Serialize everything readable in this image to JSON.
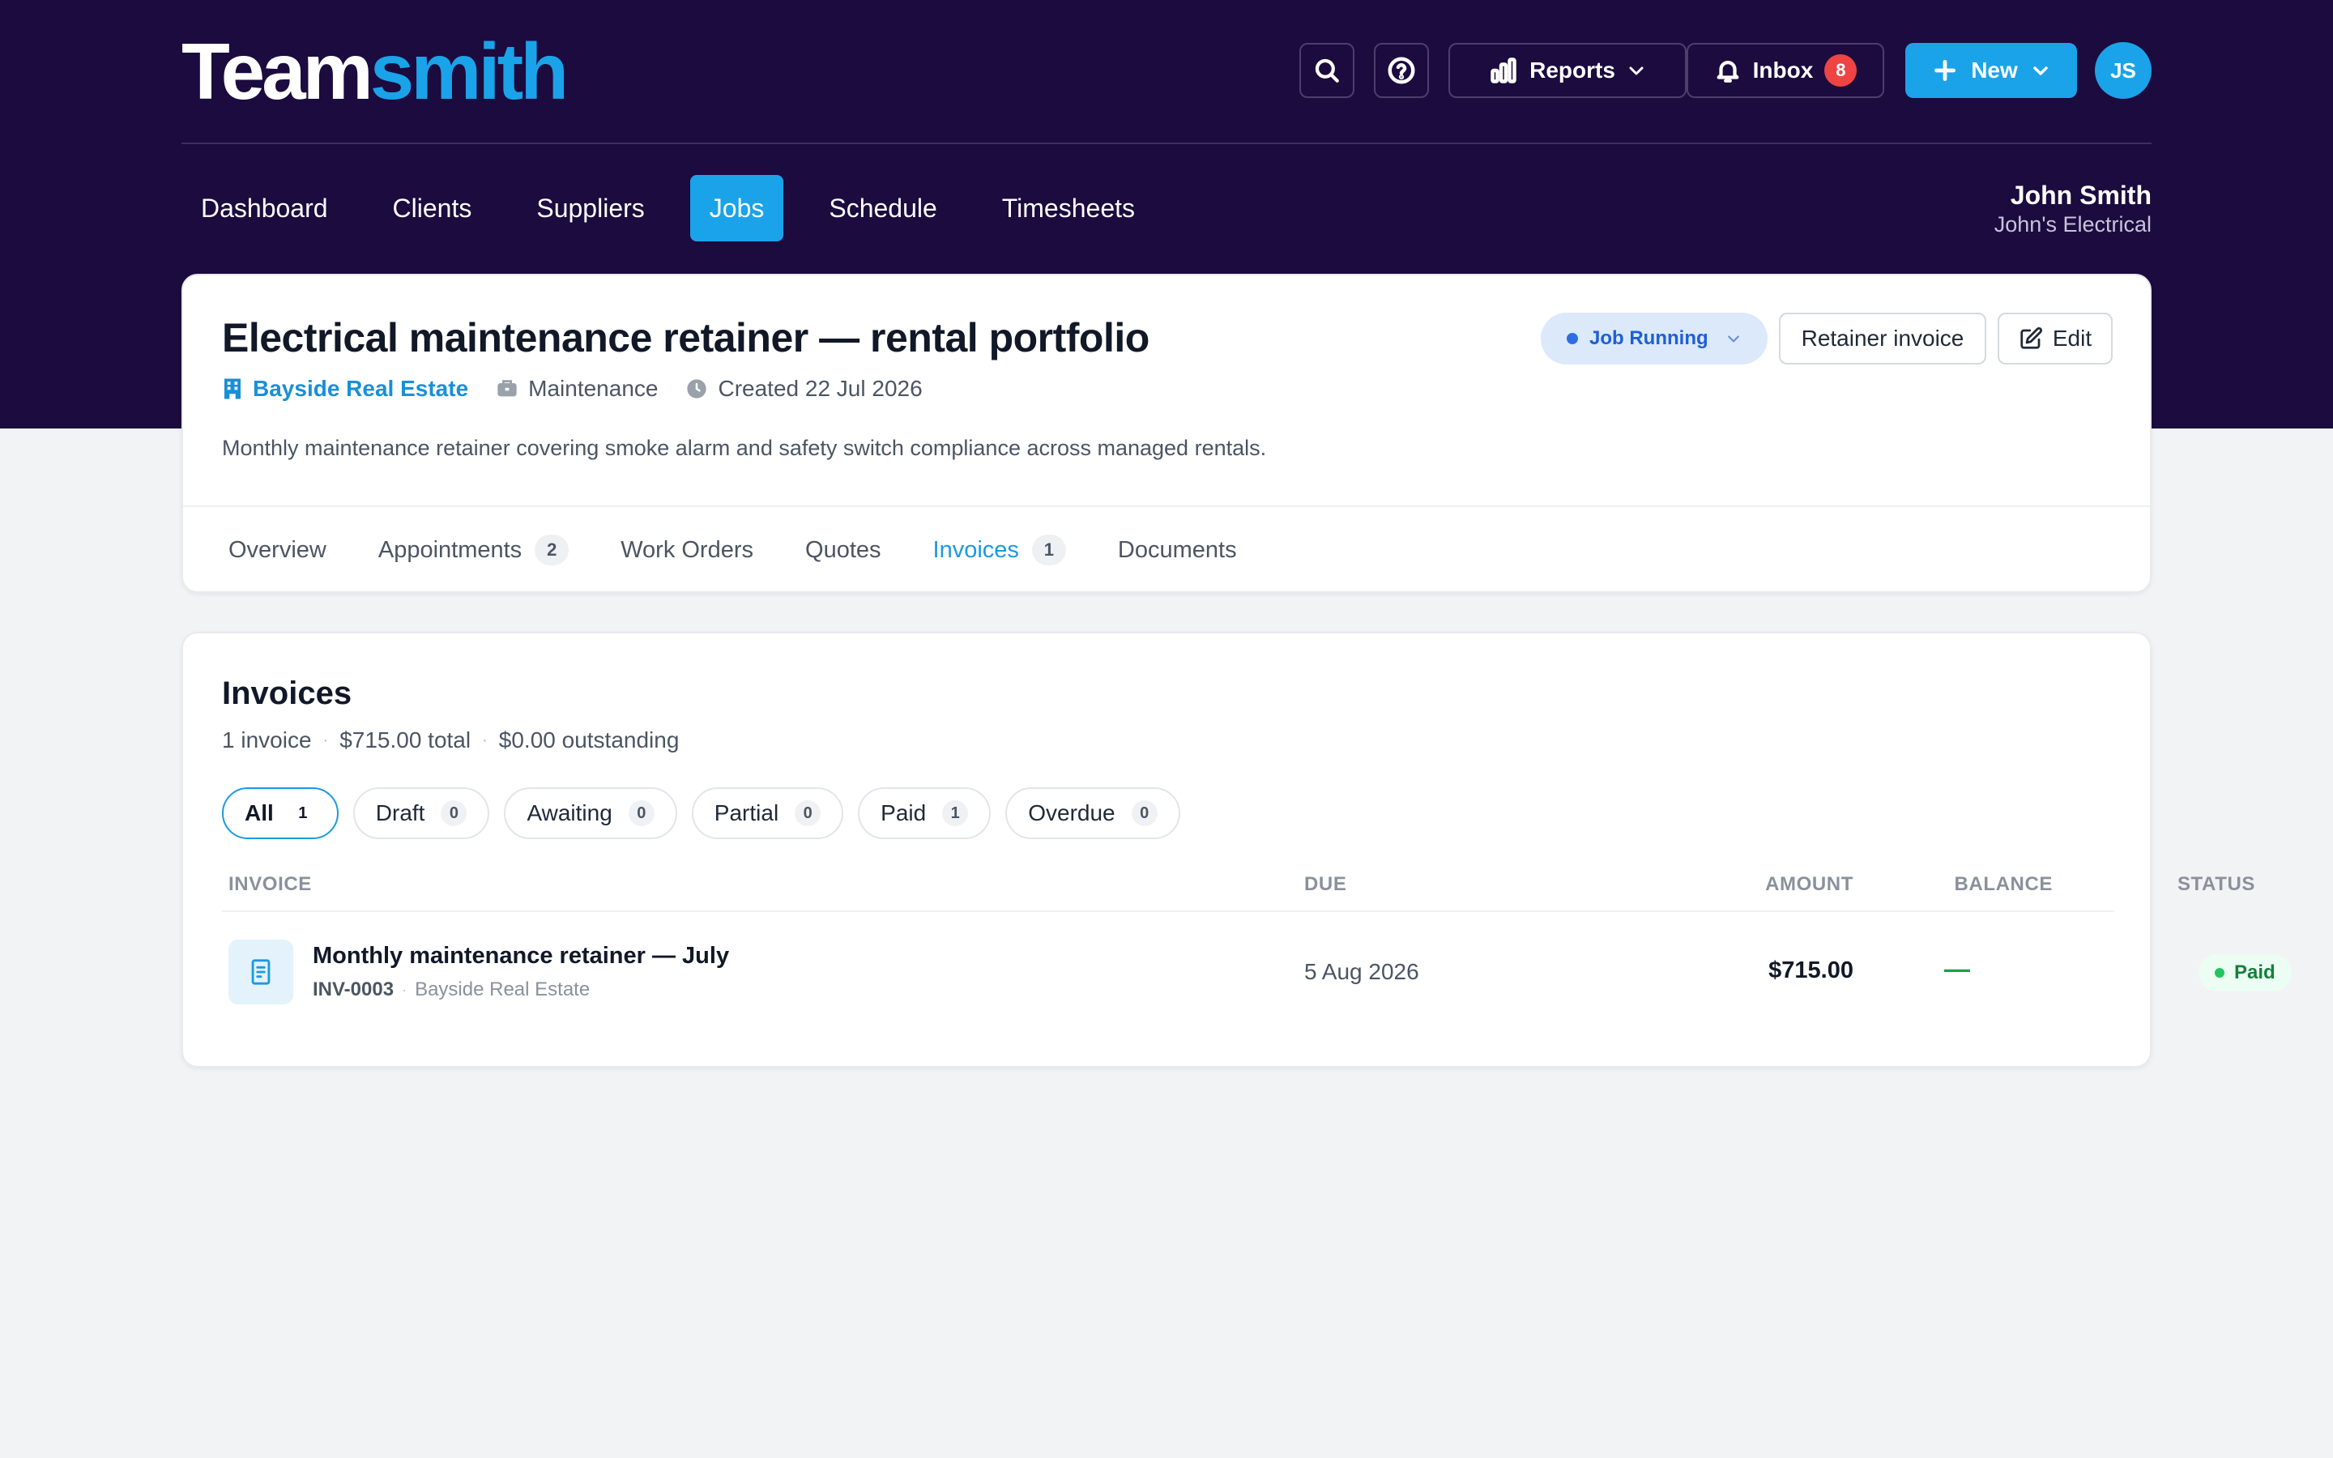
{
  "app": {
    "logo_a": "Team",
    "logo_b": "smith"
  },
  "toolbar": {
    "reports_label": "Reports",
    "inbox_label": "Inbox",
    "inbox_count": "8",
    "new_label": "New",
    "avatar_initials": "JS"
  },
  "nav": {
    "items": [
      {
        "label": "Dashboard"
      },
      {
        "label": "Clients"
      },
      {
        "label": "Suppliers"
      },
      {
        "label": "Jobs",
        "active": true
      },
      {
        "label": "Schedule"
      },
      {
        "label": "Timesheets"
      }
    ]
  },
  "user": {
    "name": "John Smith",
    "company": "John's Electrical"
  },
  "job": {
    "title": "Electrical maintenance retainer — rental portfolio",
    "client": "Bayside Real Estate",
    "type": "Maintenance",
    "created": "Created 22 Jul 2026",
    "description": "Monthly maintenance retainer covering smoke alarm and safety switch compliance across managed rentals.",
    "status": "Job Running",
    "retainer_button": "Retainer invoice",
    "edit_button": "Edit"
  },
  "tabs": [
    {
      "label": "Overview",
      "count": ""
    },
    {
      "label": "Appointments",
      "count": "2"
    },
    {
      "label": "Work Orders",
      "count": ""
    },
    {
      "label": "Quotes",
      "count": ""
    },
    {
      "label": "Invoices",
      "count": "1",
      "active": true
    },
    {
      "label": "Documents",
      "count": ""
    }
  ],
  "invoices": {
    "title": "Invoices",
    "summary": {
      "count": "1 invoice",
      "total": "$715.00 total",
      "outstanding": "$0.00 outstanding"
    },
    "filters": [
      {
        "label": "All",
        "count": "1"
      },
      {
        "label": "Draft",
        "count": "0"
      },
      {
        "label": "Awaiting",
        "count": "0"
      },
      {
        "label": "Partial",
        "count": "0"
      },
      {
        "label": "Paid",
        "count": "1"
      },
      {
        "label": "Overdue",
        "count": "0"
      }
    ],
    "columns": {
      "invoice": "INVOICE",
      "due": "DUE",
      "amount": "AMOUNT",
      "balance": "BALANCE",
      "status": "STATUS"
    },
    "rows": [
      {
        "name": "Monthly maintenance retainer — July",
        "number": "INV-0003",
        "client": "Bayside Real Estate",
        "due": "5 Aug 2026",
        "amount": "$715.00",
        "balance": "—",
        "status": "Paid"
      }
    ]
  },
  "colors": {
    "brand_dark": "#1b0b3e",
    "accent": "#1aa3e8",
    "status_running": "#2f6de6",
    "status_paid": "#22c55e",
    "badge_red": "#ef4444"
  }
}
